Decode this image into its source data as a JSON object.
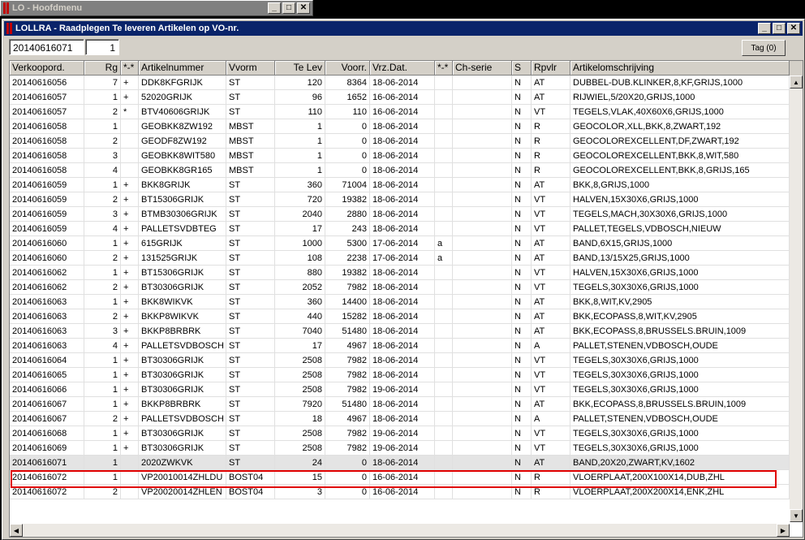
{
  "bg_window": {
    "title": "LO - Hoofdmenu"
  },
  "main_window": {
    "title": "LOLLRA - Raadplegen Te leveren Artikelen op VO-nr."
  },
  "toolbar": {
    "order_value": "20140616071",
    "seq_value": "1",
    "tag_label": "Tag (0)"
  },
  "columns": [
    "Verkoopord.",
    "Rg",
    "*-*",
    "Artikelnummer",
    "Vvorm",
    "Te Lev",
    "Voorr.",
    "Vrz.Dat.",
    "*-*",
    "Ch-serie",
    "S",
    "Rpvlr",
    "Artikelomschrijving"
  ],
  "rows": [
    [
      "20140616056",
      "7",
      "+",
      "DDK8KFGRIJK",
      "ST",
      "120",
      "8364",
      "18-06-2014",
      "",
      "",
      "N",
      "AT",
      "DUBBEL-DUB.KLINKER,8,KF,GRIJS,1000"
    ],
    [
      "20140616057",
      "1",
      "+",
      "52020GRIJK",
      "ST",
      "96",
      "1652",
      "16-06-2014",
      "",
      "",
      "N",
      "AT",
      "RIJWIEL,5/20X20,GRIJS,1000"
    ],
    [
      "20140616057",
      "2",
      "*",
      "BTV40606GRIJK",
      "ST",
      "110",
      "110",
      "16-06-2014",
      "",
      "",
      "N",
      "VT",
      "TEGELS,VLAK,40X60X6,GRIJS,1000"
    ],
    [
      "20140616058",
      "1",
      "",
      "GEOBKK8ZW192",
      "MBST",
      "1",
      "0",
      "18-06-2014",
      "",
      "",
      "N",
      "R",
      "GEOCOLOR,XLL,BKK,8,ZWART,192"
    ],
    [
      "20140616058",
      "2",
      "",
      "GEODF8ZW192",
      "MBST",
      "1",
      "0",
      "18-06-2014",
      "",
      "",
      "N",
      "R",
      "GEOCOLOREXCELLENT,DF,ZWART,192"
    ],
    [
      "20140616058",
      "3",
      "",
      "GEOBKK8WIT580",
      "MBST",
      "1",
      "0",
      "18-06-2014",
      "",
      "",
      "N",
      "R",
      "GEOCOLOREXCELLENT,BKK,8,WIT,580"
    ],
    [
      "20140616058",
      "4",
      "",
      "GEOBKK8GR165",
      "MBST",
      "1",
      "0",
      "18-06-2014",
      "",
      "",
      "N",
      "R",
      "GEOCOLOREXCELLENT,BKK,8,GRIJS,165"
    ],
    [
      "20140616059",
      "1",
      "+",
      "BKK8GRIJK",
      "ST",
      "360",
      "71004",
      "18-06-2014",
      "",
      "",
      "N",
      "AT",
      "BKK,8,GRIJS,1000"
    ],
    [
      "20140616059",
      "2",
      "+",
      "BT15306GRIJK",
      "ST",
      "720",
      "19382",
      "18-06-2014",
      "",
      "",
      "N",
      "VT",
      "HALVEN,15X30X6,GRIJS,1000"
    ],
    [
      "20140616059",
      "3",
      "+",
      "BTMB30306GRIJK",
      "ST",
      "2040",
      "2880",
      "18-06-2014",
      "",
      "",
      "N",
      "VT",
      "TEGELS,MACH,30X30X6,GRIJS,1000"
    ],
    [
      "20140616059",
      "4",
      "+",
      "PALLETSVDBTEG",
      "ST",
      "17",
      "243",
      "18-06-2014",
      "",
      "",
      "N",
      "VT",
      "PALLET,TEGELS,VDBOSCH,NIEUW"
    ],
    [
      "20140616060",
      "1",
      "+",
      "615GRIJK",
      "ST",
      "1000",
      "5300",
      "17-06-2014",
      "a",
      "",
      "N",
      "AT",
      "BAND,6X15,GRIJS,1000"
    ],
    [
      "20140616060",
      "2",
      "+",
      "131525GRIJK",
      "ST",
      "108",
      "2238",
      "17-06-2014",
      "a",
      "",
      "N",
      "AT",
      "BAND,13/15X25,GRIJS,1000"
    ],
    [
      "20140616062",
      "1",
      "+",
      "BT15306GRIJK",
      "ST",
      "880",
      "19382",
      "18-06-2014",
      "",
      "",
      "N",
      "VT",
      "HALVEN,15X30X6,GRIJS,1000"
    ],
    [
      "20140616062",
      "2",
      "+",
      "BT30306GRIJK",
      "ST",
      "2052",
      "7982",
      "18-06-2014",
      "",
      "",
      "N",
      "VT",
      "TEGELS,30X30X6,GRIJS,1000"
    ],
    [
      "20140616063",
      "1",
      "+",
      "BKK8WIKVK",
      "ST",
      "360",
      "14400",
      "18-06-2014",
      "",
      "",
      "N",
      "AT",
      "BKK,8,WIT,KV,2905"
    ],
    [
      "20140616063",
      "2",
      "+",
      "BKKP8WIKVK",
      "ST",
      "440",
      "15282",
      "18-06-2014",
      "",
      "",
      "N",
      "AT",
      "BKK,ECOPASS,8,WIT,KV,2905"
    ],
    [
      "20140616063",
      "3",
      "+",
      "BKKP8BRBRK",
      "ST",
      "7040",
      "51480",
      "18-06-2014",
      "",
      "",
      "N",
      "AT",
      "BKK,ECOPASS,8,BRUSSELS.BRUIN,1009"
    ],
    [
      "20140616063",
      "4",
      "+",
      "PALLETSVDBOSCH",
      "ST",
      "17",
      "4967",
      "18-06-2014",
      "",
      "",
      "N",
      "A",
      "PALLET,STENEN,VDBOSCH,OUDE"
    ],
    [
      "20140616064",
      "1",
      "+",
      "BT30306GRIJK",
      "ST",
      "2508",
      "7982",
      "18-06-2014",
      "",
      "",
      "N",
      "VT",
      "TEGELS,30X30X6,GRIJS,1000"
    ],
    [
      "20140616065",
      "1",
      "+",
      "BT30306GRIJK",
      "ST",
      "2508",
      "7982",
      "18-06-2014",
      "",
      "",
      "N",
      "VT",
      "TEGELS,30X30X6,GRIJS,1000"
    ],
    [
      "20140616066",
      "1",
      "+",
      "BT30306GRIJK",
      "ST",
      "2508",
      "7982",
      "19-06-2014",
      "",
      "",
      "N",
      "VT",
      "TEGELS,30X30X6,GRIJS,1000"
    ],
    [
      "20140616067",
      "1",
      "+",
      "BKKP8BRBRK",
      "ST",
      "7920",
      "51480",
      "18-06-2014",
      "",
      "",
      "N",
      "AT",
      "BKK,ECOPASS,8,BRUSSELS.BRUIN,1009"
    ],
    [
      "20140616067",
      "2",
      "+",
      "PALLETSVDBOSCH",
      "ST",
      "18",
      "4967",
      "18-06-2014",
      "",
      "",
      "N",
      "A",
      "PALLET,STENEN,VDBOSCH,OUDE"
    ],
    [
      "20140616068",
      "1",
      "+",
      "BT30306GRIJK",
      "ST",
      "2508",
      "7982",
      "19-06-2014",
      "",
      "",
      "N",
      "VT",
      "TEGELS,30X30X6,GRIJS,1000"
    ],
    [
      "20140616069",
      "1",
      "+",
      "BT30306GRIJK",
      "ST",
      "2508",
      "7982",
      "19-06-2014",
      "",
      "",
      "N",
      "VT",
      "TEGELS,30X30X6,GRIJS,1000"
    ],
    [
      "20140616071",
      "1",
      "",
      "2020ZWKVK",
      "ST",
      "24",
      "0",
      "18-06-2014",
      "",
      "",
      "N",
      "AT",
      "BAND,20X20,ZWART,KV,1602"
    ],
    [
      "20140616072",
      "1",
      "",
      "VP20010014ZHLDU",
      "BOST04",
      "15",
      "0",
      "16-06-2014",
      "",
      "",
      "N",
      "R",
      "VLOERPLAAT,200X100X14,DUB,ZHL"
    ],
    [
      "20140616072",
      "2",
      "",
      "VP20020014ZHLEN",
      "BOST04",
      "3",
      "0",
      "16-06-2014",
      "",
      "",
      "N",
      "R",
      "VLOERPLAAT,200X200X14,ENK,ZHL"
    ]
  ],
  "selected_row": 26,
  "highlight_color": "#e00000"
}
